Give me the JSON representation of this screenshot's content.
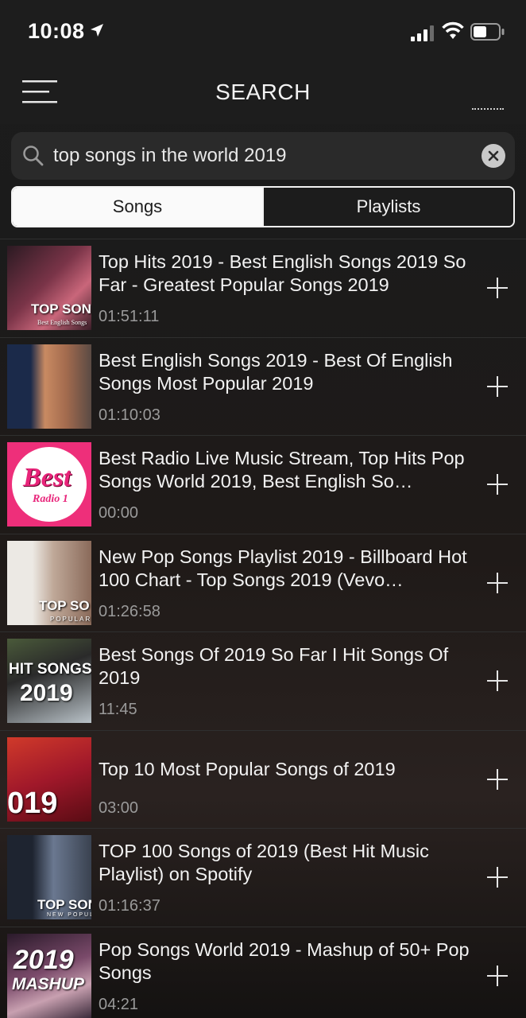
{
  "status_bar": {
    "time": "10:08"
  },
  "nav": {
    "title": "SEARCH"
  },
  "search": {
    "query": "top songs in the world 2019"
  },
  "segments": {
    "songs": "Songs",
    "playlists": "Playlists"
  },
  "results": [
    {
      "title": "Top Hits 2019 - Best English Songs 2019 So Far - Greatest Popular Songs 2019",
      "duration": "01:51:11",
      "thumb_caption": "TOP SON",
      "thumb_subcaption": "Best English Songs",
      "thumb_color": "#5b2a3a"
    },
    {
      "title": "Best English Songs 2019 - Best Of English Songs Most Popular 2019",
      "duration": "01:10:03",
      "thumb_caption": "",
      "thumb_subcaption": "",
      "thumb_color": "#7a6a5e"
    },
    {
      "title": "Best Radio Live Music Stream, Top Hits Pop Songs World 2019, Best English So…",
      "duration": "00:00",
      "thumb_caption": "Best",
      "thumb_subcaption": "Radio 1",
      "thumb_color": "#ee2f7a"
    },
    {
      "title": "New Pop Songs Playlist 2019 - Billboard Hot 100 Chart - Top Songs 2019 (Vevo…",
      "duration": "01:26:58",
      "thumb_caption": "TOP SO",
      "thumb_subcaption": "POPULAR",
      "thumb_color": "#d8d4cf"
    },
    {
      "title": "Best  Songs Of 2019 So Far I Hit Songs Of 2019",
      "duration": "11:45",
      "thumb_caption": "HIT SONGS",
      "thumb_subcaption": "2019",
      "thumb_color": "#3b4a3a"
    },
    {
      "title": "Top 10 Most Popular Songs of 2019",
      "duration": "03:00",
      "thumb_caption": "019",
      "thumb_subcaption": "",
      "thumb_color": "#b3242a"
    },
    {
      "title": "TOP 100 Songs of 2019 (Best Hit Music Playlist) on Spotify",
      "duration": "01:16:37",
      "thumb_caption": "TOP SON",
      "thumb_subcaption": "NEW POPULAR",
      "thumb_color": "#3f4a58"
    },
    {
      "title": "Pop Songs World 2019 - Mashup of 50+ Pop Songs",
      "duration": "04:21",
      "thumb_caption": "2019",
      "thumb_subcaption": "MASHUP",
      "thumb_color": "#6a4a5a"
    }
  ],
  "colors": {
    "background": "#1c1c1c",
    "segment_active": "#fafafa",
    "duration_text": "#9a9a9a"
  }
}
